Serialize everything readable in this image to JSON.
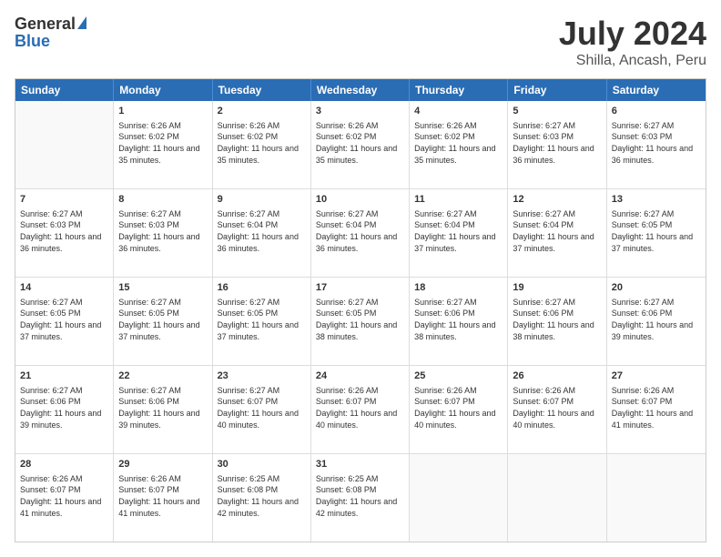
{
  "logo": {
    "general": "General",
    "blue": "Blue"
  },
  "title": "July 2024",
  "subtitle": "Shilla, Ancash, Peru",
  "header_days": [
    "Sunday",
    "Monday",
    "Tuesday",
    "Wednesday",
    "Thursday",
    "Friday",
    "Saturday"
  ],
  "weeks": [
    [
      {
        "day": "",
        "sunrise": "",
        "sunset": "",
        "daylight": "",
        "empty": true
      },
      {
        "day": "1",
        "sunrise": "Sunrise: 6:26 AM",
        "sunset": "Sunset: 6:02 PM",
        "daylight": "Daylight: 11 hours and 35 minutes."
      },
      {
        "day": "2",
        "sunrise": "Sunrise: 6:26 AM",
        "sunset": "Sunset: 6:02 PM",
        "daylight": "Daylight: 11 hours and 35 minutes."
      },
      {
        "day": "3",
        "sunrise": "Sunrise: 6:26 AM",
        "sunset": "Sunset: 6:02 PM",
        "daylight": "Daylight: 11 hours and 35 minutes."
      },
      {
        "day": "4",
        "sunrise": "Sunrise: 6:26 AM",
        "sunset": "Sunset: 6:02 PM",
        "daylight": "Daylight: 11 hours and 35 minutes."
      },
      {
        "day": "5",
        "sunrise": "Sunrise: 6:27 AM",
        "sunset": "Sunset: 6:03 PM",
        "daylight": "Daylight: 11 hours and 36 minutes."
      },
      {
        "day": "6",
        "sunrise": "Sunrise: 6:27 AM",
        "sunset": "Sunset: 6:03 PM",
        "daylight": "Daylight: 11 hours and 36 minutes."
      }
    ],
    [
      {
        "day": "7",
        "sunrise": "Sunrise: 6:27 AM",
        "sunset": "Sunset: 6:03 PM",
        "daylight": "Daylight: 11 hours and 36 minutes."
      },
      {
        "day": "8",
        "sunrise": "Sunrise: 6:27 AM",
        "sunset": "Sunset: 6:03 PM",
        "daylight": "Daylight: 11 hours and 36 minutes."
      },
      {
        "day": "9",
        "sunrise": "Sunrise: 6:27 AM",
        "sunset": "Sunset: 6:04 PM",
        "daylight": "Daylight: 11 hours and 36 minutes."
      },
      {
        "day": "10",
        "sunrise": "Sunrise: 6:27 AM",
        "sunset": "Sunset: 6:04 PM",
        "daylight": "Daylight: 11 hours and 36 minutes."
      },
      {
        "day": "11",
        "sunrise": "Sunrise: 6:27 AM",
        "sunset": "Sunset: 6:04 PM",
        "daylight": "Daylight: 11 hours and 37 minutes."
      },
      {
        "day": "12",
        "sunrise": "Sunrise: 6:27 AM",
        "sunset": "Sunset: 6:04 PM",
        "daylight": "Daylight: 11 hours and 37 minutes."
      },
      {
        "day": "13",
        "sunrise": "Sunrise: 6:27 AM",
        "sunset": "Sunset: 6:05 PM",
        "daylight": "Daylight: 11 hours and 37 minutes."
      }
    ],
    [
      {
        "day": "14",
        "sunrise": "Sunrise: 6:27 AM",
        "sunset": "Sunset: 6:05 PM",
        "daylight": "Daylight: 11 hours and 37 minutes."
      },
      {
        "day": "15",
        "sunrise": "Sunrise: 6:27 AM",
        "sunset": "Sunset: 6:05 PM",
        "daylight": "Daylight: 11 hours and 37 minutes."
      },
      {
        "day": "16",
        "sunrise": "Sunrise: 6:27 AM",
        "sunset": "Sunset: 6:05 PM",
        "daylight": "Daylight: 11 hours and 37 minutes."
      },
      {
        "day": "17",
        "sunrise": "Sunrise: 6:27 AM",
        "sunset": "Sunset: 6:05 PM",
        "daylight": "Daylight: 11 hours and 38 minutes."
      },
      {
        "day": "18",
        "sunrise": "Sunrise: 6:27 AM",
        "sunset": "Sunset: 6:06 PM",
        "daylight": "Daylight: 11 hours and 38 minutes."
      },
      {
        "day": "19",
        "sunrise": "Sunrise: 6:27 AM",
        "sunset": "Sunset: 6:06 PM",
        "daylight": "Daylight: 11 hours and 38 minutes."
      },
      {
        "day": "20",
        "sunrise": "Sunrise: 6:27 AM",
        "sunset": "Sunset: 6:06 PM",
        "daylight": "Daylight: 11 hours and 39 minutes."
      }
    ],
    [
      {
        "day": "21",
        "sunrise": "Sunrise: 6:27 AM",
        "sunset": "Sunset: 6:06 PM",
        "daylight": "Daylight: 11 hours and 39 minutes."
      },
      {
        "day": "22",
        "sunrise": "Sunrise: 6:27 AM",
        "sunset": "Sunset: 6:06 PM",
        "daylight": "Daylight: 11 hours and 39 minutes."
      },
      {
        "day": "23",
        "sunrise": "Sunrise: 6:27 AM",
        "sunset": "Sunset: 6:07 PM",
        "daylight": "Daylight: 11 hours and 40 minutes."
      },
      {
        "day": "24",
        "sunrise": "Sunrise: 6:26 AM",
        "sunset": "Sunset: 6:07 PM",
        "daylight": "Daylight: 11 hours and 40 minutes."
      },
      {
        "day": "25",
        "sunrise": "Sunrise: 6:26 AM",
        "sunset": "Sunset: 6:07 PM",
        "daylight": "Daylight: 11 hours and 40 minutes."
      },
      {
        "day": "26",
        "sunrise": "Sunrise: 6:26 AM",
        "sunset": "Sunset: 6:07 PM",
        "daylight": "Daylight: 11 hours and 40 minutes."
      },
      {
        "day": "27",
        "sunrise": "Sunrise: 6:26 AM",
        "sunset": "Sunset: 6:07 PM",
        "daylight": "Daylight: 11 hours and 41 minutes."
      }
    ],
    [
      {
        "day": "28",
        "sunrise": "Sunrise: 6:26 AM",
        "sunset": "Sunset: 6:07 PM",
        "daylight": "Daylight: 11 hours and 41 minutes."
      },
      {
        "day": "29",
        "sunrise": "Sunrise: 6:26 AM",
        "sunset": "Sunset: 6:07 PM",
        "daylight": "Daylight: 11 hours and 41 minutes."
      },
      {
        "day": "30",
        "sunrise": "Sunrise: 6:25 AM",
        "sunset": "Sunset: 6:08 PM",
        "daylight": "Daylight: 11 hours and 42 minutes."
      },
      {
        "day": "31",
        "sunrise": "Sunrise: 6:25 AM",
        "sunset": "Sunset: 6:08 PM",
        "daylight": "Daylight: 11 hours and 42 minutes."
      },
      {
        "day": "",
        "sunrise": "",
        "sunset": "",
        "daylight": "",
        "empty": true
      },
      {
        "day": "",
        "sunrise": "",
        "sunset": "",
        "daylight": "",
        "empty": true
      },
      {
        "day": "",
        "sunrise": "",
        "sunset": "",
        "daylight": "",
        "empty": true
      }
    ]
  ]
}
